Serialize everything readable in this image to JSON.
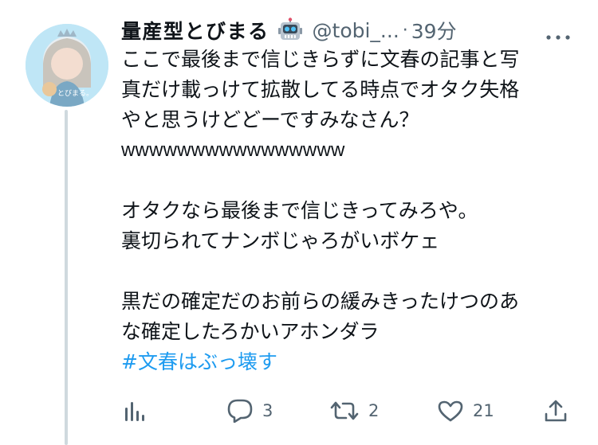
{
  "tweet": {
    "display_name": "量産型とびまる",
    "handle": "@tobi_...",
    "separator": "·",
    "time": "39分",
    "lines": [
      "ここで最後まで信じきらずに文春の記事と写",
      "真だけ載っけて拡散してる時点でオタク失格",
      "やと思うけどどーですみなさん？",
      "wwwwwwwwwwwwwwww",
      "",
      "オタクなら最後まで信じきってみろや。",
      "裏切られてナンボじゃろがいボケェ",
      "",
      "黒だの確定だのお前らの緩みきったけつのあ",
      "な確定したろかいアホンダラ"
    ],
    "hashtag": "#文春はぶっ壊す"
  },
  "actions": {
    "analytics": "",
    "replies": "3",
    "retweets": "2",
    "likes": "21",
    "share": ""
  },
  "icons": {
    "name_badge": "robot-face-emoji",
    "more": "more-dots-icon",
    "analytics": "analytics-bars-icon",
    "reply": "reply-bubble-icon",
    "retweet": "retweet-icon",
    "like": "heart-icon",
    "share": "share-upload-icon"
  },
  "colors": {
    "text": "#0f1419",
    "secondary": "#536471",
    "link": "#1d9bf0",
    "thread_line": "#cfd9de"
  }
}
